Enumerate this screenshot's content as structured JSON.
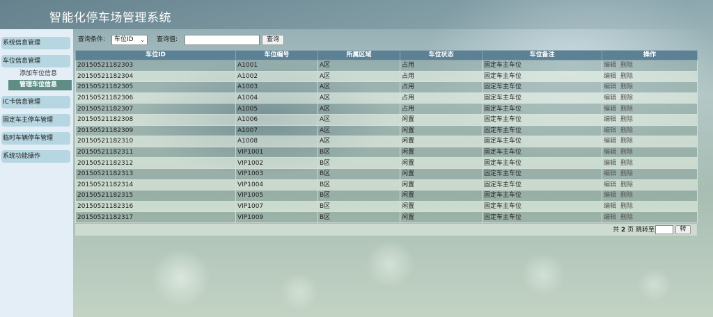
{
  "header": {
    "title": "智能化停车场管理系统"
  },
  "sidebar": {
    "menus": [
      "系统信息管理",
      "车位信息管理",
      "IC卡信息管理",
      "固定车主停车管理",
      "临时车辆停车管理",
      "系统功能操作"
    ],
    "sub_items": [
      "添加车位信息",
      "管理车位信息"
    ]
  },
  "search": {
    "condition_label": "查询条件:",
    "condition_value": "车位ID",
    "value_label": "查询值:",
    "value_input": "",
    "button": "查询"
  },
  "table": {
    "columns": [
      "车位ID",
      "车位编号",
      "所属区域",
      "车位状态",
      "车位备注",
      "操作"
    ],
    "rows": [
      [
        "20150521182303",
        "A1001",
        "A区",
        "占用",
        "固定车主车位"
      ],
      [
        "20150521182304",
        "A1002",
        "A区",
        "占用",
        "固定车主车位"
      ],
      [
        "20150521182305",
        "A1003",
        "A区",
        "占用",
        "固定车主车位"
      ],
      [
        "20150521182306",
        "A1004",
        "A区",
        "占用",
        "固定车主车位"
      ],
      [
        "20150521182307",
        "A1005",
        "A区",
        "占用",
        "固定车主车位"
      ],
      [
        "20150521182308",
        "A1006",
        "A区",
        "闲置",
        "固定车主车位"
      ],
      [
        "20150521182309",
        "A1007",
        "A区",
        "闲置",
        "固定车主车位"
      ],
      [
        "20150521182310",
        "A1008",
        "A区",
        "闲置",
        "固定车主车位"
      ],
      [
        "20150521182311",
        "VIP1001",
        "B区",
        "闲置",
        "固定车主车位"
      ],
      [
        "20150521182312",
        "VIP1002",
        "B区",
        "闲置",
        "固定车主车位"
      ],
      [
        "20150521182313",
        "VIP1003",
        "B区",
        "闲置",
        "固定车主车位"
      ],
      [
        "20150521182314",
        "VIP1004",
        "B区",
        "闲置",
        "固定车主车位"
      ],
      [
        "20150521182315",
        "VIP1005",
        "B区",
        "闲置",
        "固定车主车位"
      ],
      [
        "20150521182316",
        "VIP1007",
        "B区",
        "闲置",
        "固定车主车位"
      ],
      [
        "20150521182317",
        "VIP1009",
        "B区",
        "闲置",
        "固定车主车位"
      ]
    ],
    "edit_label": "编辑",
    "delete_label": "删除"
  },
  "pager": {
    "prefix": "共",
    "total_pages": "2",
    "suffix": "页 跳转至",
    "go_button": "转"
  },
  "colors": {
    "header_bg": "#5d8194",
    "active_menu": "#5f8d86",
    "menu_bg": "#b6d6e2",
    "sidebar_bg": "#e3eef6"
  }
}
